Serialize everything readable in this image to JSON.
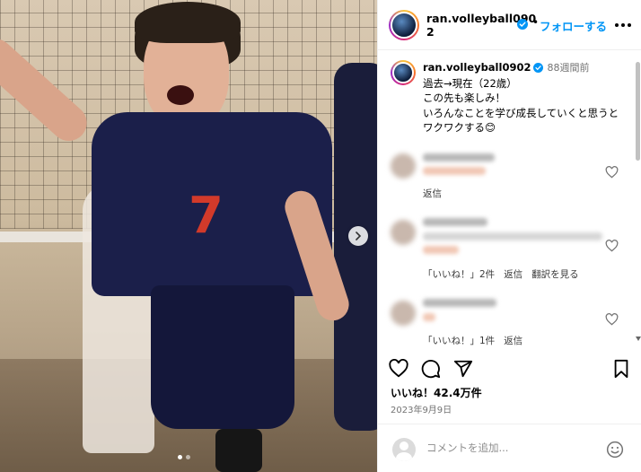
{
  "post": {
    "username": "ran.volleyball0902",
    "follow_label": "フォローする",
    "dot": "•",
    "caption_time": "88週間前",
    "caption_text": "過去→現在（22歳）\nこの先も楽しみ！\nいろんなことを学び成長していくと思うとワクワクする😊",
    "photo_number": "7"
  },
  "comments": [
    {
      "reply_label": "返信"
    },
    {
      "likes_label": "「いいね！」2件",
      "reply_label": "返信",
      "translate_label": "翻訳を見る"
    },
    {
      "likes_label": "「いいね！」1件",
      "reply_label": "返信"
    }
  ],
  "footer": {
    "likes": "いいね！42.4万件",
    "date": "2023年9月9日",
    "comment_placeholder": "コメントを追加..."
  },
  "colors": {
    "accent": "#0095f6",
    "verified": "#0095f6",
    "secondary_text": "#737373"
  },
  "icons": [
    "heart-icon",
    "comment-icon",
    "share-icon",
    "bookmark-icon",
    "verified-icon",
    "emoji-icon",
    "chevron-right-icon",
    "more-icon"
  ]
}
